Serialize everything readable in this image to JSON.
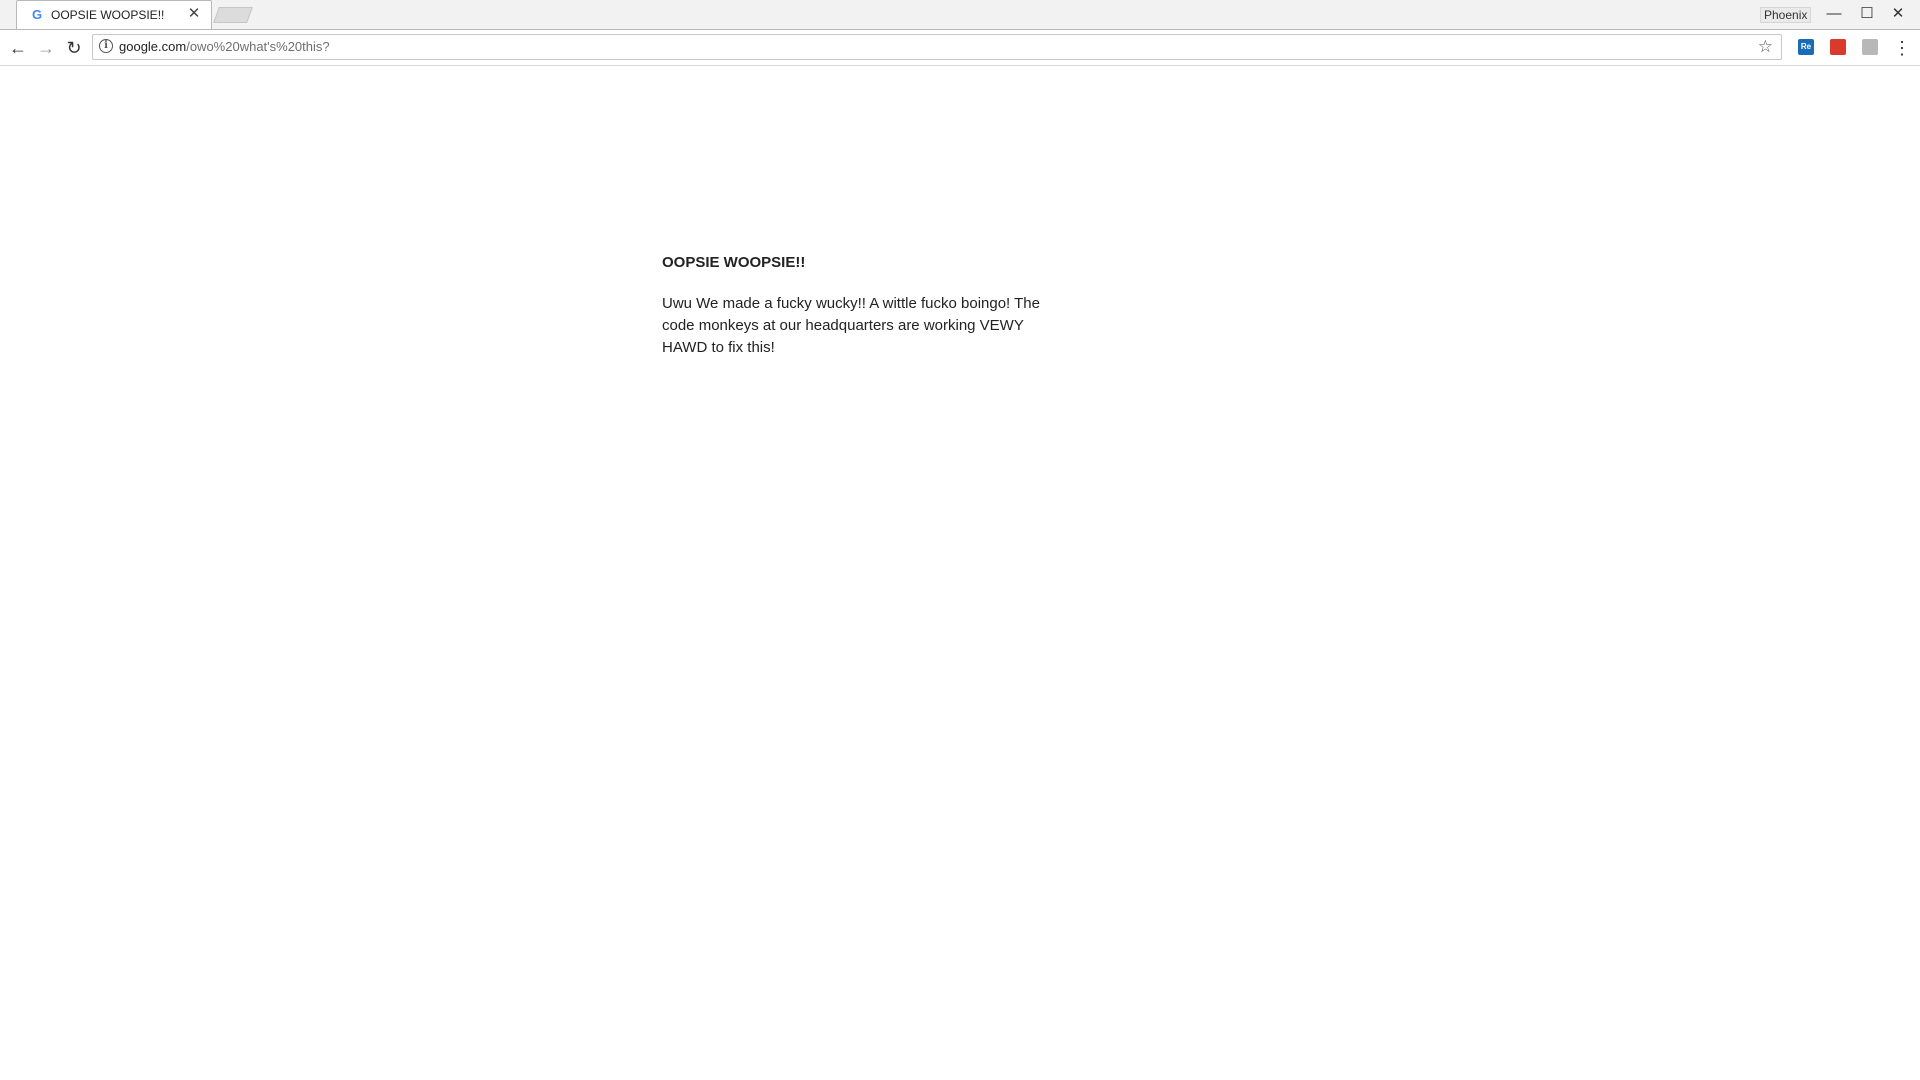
{
  "browser": {
    "tab": {
      "favicon": "G",
      "title": "OOPSIE WOOPSIE!!",
      "close_glyph": "✕"
    },
    "profile_name": "Phoenix",
    "window_controls": {
      "minimize": "—",
      "maximize": "☐",
      "close": "✕"
    },
    "nav": {
      "back": "←",
      "forward": "→",
      "reload": "↻"
    },
    "omnibox": {
      "info_glyph": "i",
      "url_host": "google.com",
      "url_path": "/owo%20what's%20this?",
      "bookmark_glyph": "☆"
    },
    "extensions": [
      {
        "name": "Re",
        "color": "#1a6db5"
      },
      {
        "name": "",
        "color": "#d93a2b"
      },
      {
        "name": "",
        "color": "#b8b8b8"
      }
    ],
    "menu_glyph": "⋮"
  },
  "page": {
    "heading": "OOPSIE WOOPSIE!!",
    "message": "Uwu We made a fucky wucky!! A wittle fucko boingo! The code monkeys at our headquarters are working VEWY HAWD to fix this!"
  }
}
